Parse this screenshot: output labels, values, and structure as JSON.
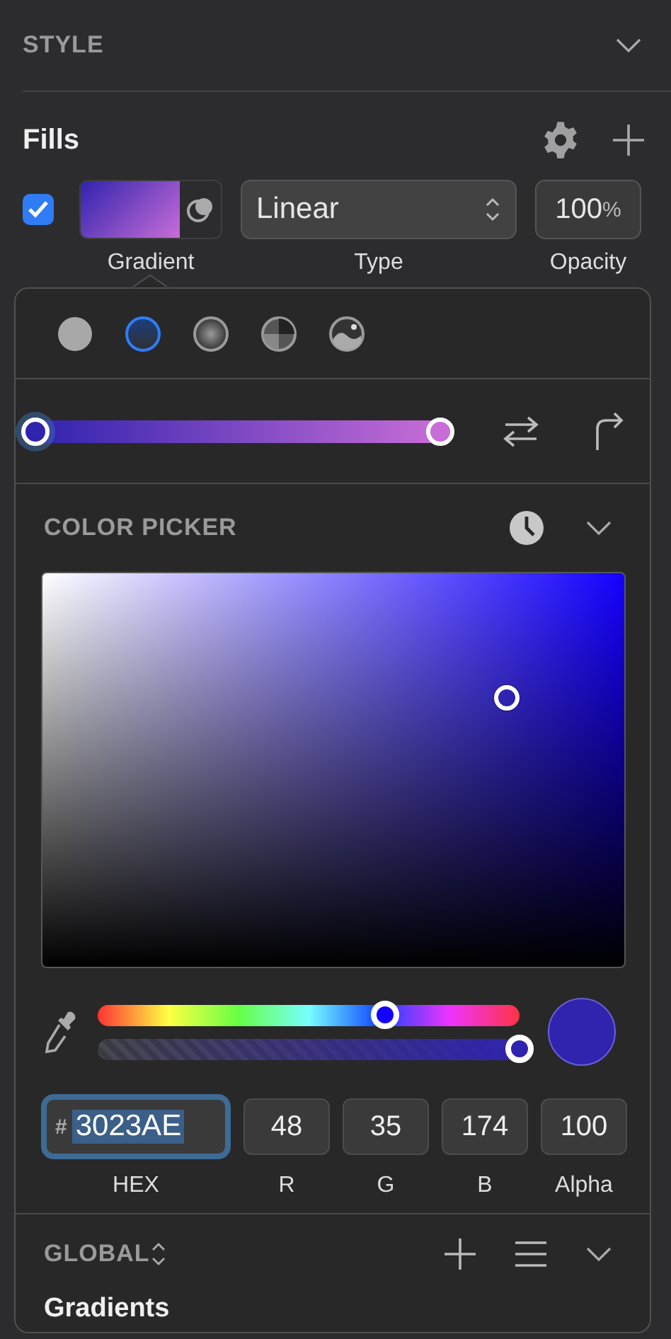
{
  "style_header": {
    "title": "STYLE",
    "expanded": true
  },
  "fills": {
    "title": "Fills",
    "enabled": true,
    "fill_label": "Gradient",
    "type_value": "Linear",
    "type_label": "Type",
    "opacity_value": "100",
    "opacity_unit": "%",
    "opacity_label": "Opacity"
  },
  "fill_types": [
    {
      "kind": "solid",
      "selected": false
    },
    {
      "kind": "linear",
      "selected": true
    },
    {
      "kind": "radial",
      "selected": false
    },
    {
      "kind": "angular",
      "selected": false
    },
    {
      "kind": "image",
      "selected": false
    }
  ],
  "gradient_stops": [
    {
      "color": "#3023ae",
      "selected": true
    },
    {
      "color": "#c86dd7",
      "selected": false
    }
  ],
  "color_picker": {
    "title": "COLOR PICKER",
    "expanded": true
  },
  "hue_slider": {
    "level": 0.68
  },
  "alpha_slider": {
    "level": 1
  },
  "fields": {
    "hex_prefix": "#",
    "hex": "3023AE",
    "hex_label": "HEX",
    "r": "48",
    "r_label": "R",
    "g": "35",
    "g_label": "G",
    "b": "174",
    "b_label": "B",
    "alpha": "100",
    "alpha_label": "Alpha"
  },
  "global": {
    "title": "GLOBAL",
    "expanded": true,
    "section": "Gradients"
  }
}
